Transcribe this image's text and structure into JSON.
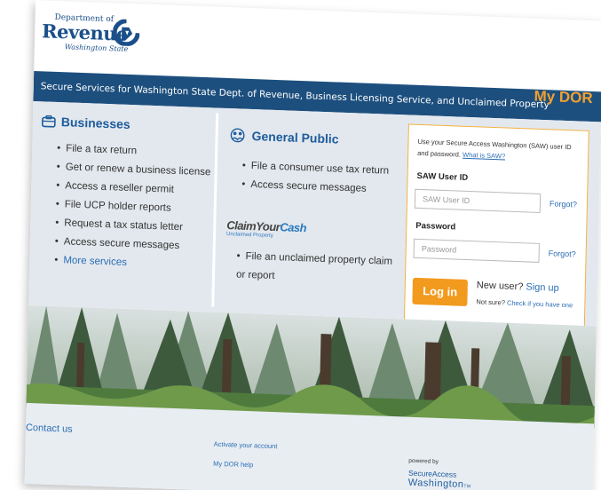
{
  "logo": {
    "dept": "Department of",
    "revenue": "Revenue",
    "state": "Washington State"
  },
  "header": {
    "banner": "Secure Services for Washington State Dept. of Revenue, Business Licensing Service, and Unclaimed Property",
    "mydor": "My DOR"
  },
  "businesses": {
    "title": "Businesses",
    "icon": "briefcase-icon",
    "items": [
      "File a tax return",
      "Get or renew a business license",
      "Access a reseller permit",
      "File UCP holder reports",
      "Request a tax status letter",
      "Access secure messages",
      "More services"
    ]
  },
  "public": {
    "title": "General Public",
    "icon": "people-icon",
    "items": [
      "File a consumer use tax return",
      "Access secure messages"
    ],
    "claim_logo_a": "ClaimYour",
    "claim_logo_b": "Cash",
    "claim_logo_sub": "Unclaimed Property",
    "claim_item": "File an unclaimed property claim or report"
  },
  "login": {
    "intro": "Use your Secure Access Washington (SAW) user ID and password.",
    "what_is": "What is SAW?",
    "userid_label": "SAW User ID",
    "userid_placeholder": "SAW User ID",
    "password_label": "Password",
    "password_placeholder": "Password",
    "forgot": "Forgot?",
    "login_button": "Log in",
    "new_user": "New user?",
    "signup": "Sign up",
    "not_sure": "Not sure?",
    "check": "Check if you have one"
  },
  "footer": {
    "contact": "Contact us",
    "activate": "Activate your account",
    "help": "My DOR help",
    "powered": "powered by",
    "saw_a": "SecureAccess",
    "saw_b": "Washington",
    "saw_tm": "TM"
  },
  "colors": {
    "navy": "#1d4f7e",
    "orange": "#f29a1e",
    "link": "#2a6db5",
    "panel": "#e3e8ee"
  }
}
